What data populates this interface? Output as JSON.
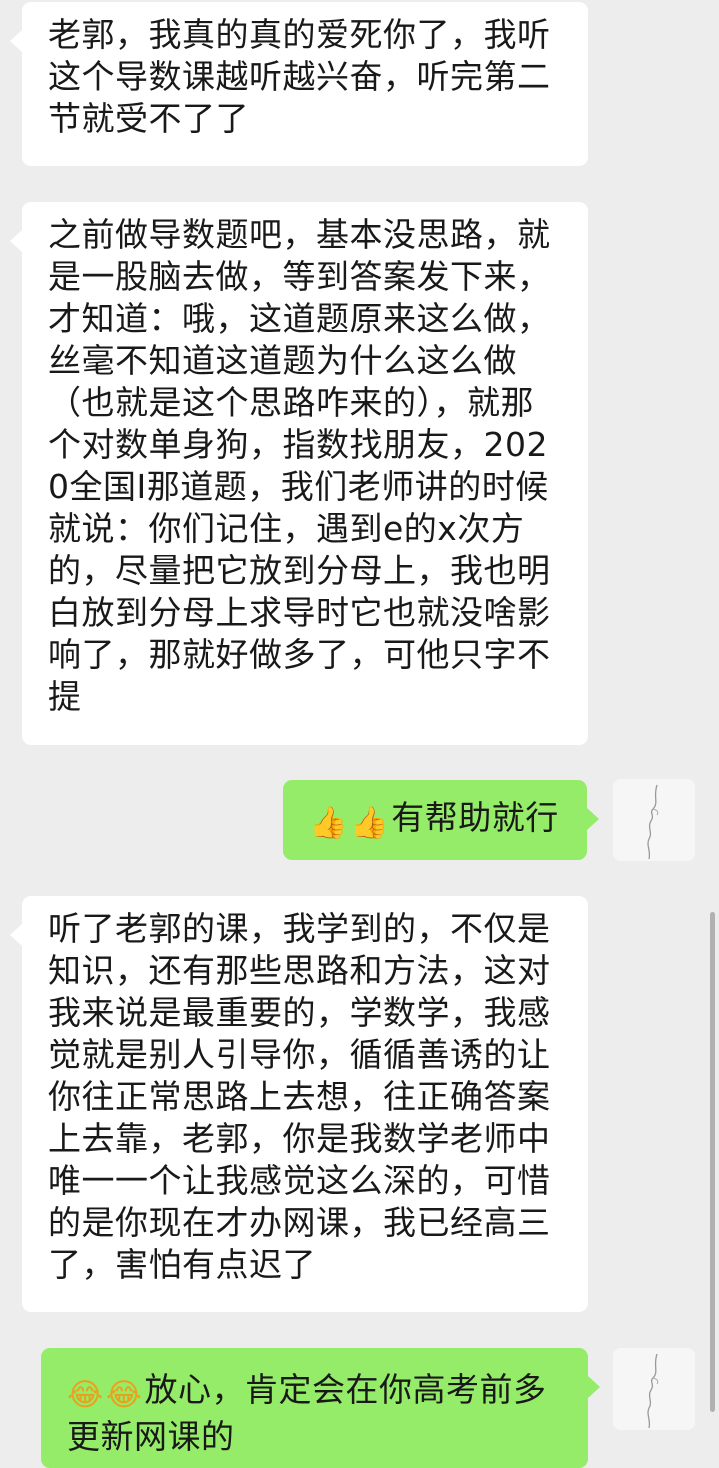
{
  "messages": [
    {
      "side": "in",
      "text": "老郭，我真的真的爱死你了，我听这个导数课越听越兴奋，听完第二节就受不了了"
    },
    {
      "side": "in",
      "text": "之前做导数题吧，基本没思路，就是一股脑去做，等到答案发下来，才知道：哦，这道题原来这么做，丝毫不知道这道题为什么这么做（也就是这个思路咋来的），就那个对数单身狗，指数找朋友，2020全国I那道题，我们老师讲的时候就说：你们记住，遇到e的x次方的，尽量把它放到分母上，我也明白放到分母上求导时它也就没啥影响了，那就好做多了，可他只字不提"
    },
    {
      "side": "out",
      "emoji": [
        "thumbs-up-icon",
        "thumbs-up-icon"
      ],
      "text": "有帮助就行"
    },
    {
      "side": "in",
      "text": "听了老郭的课，我学到的，不仅是知识，还有那些思路和方法，这对我来说是最重要的，学数学，我感觉就是别人引导你，循循善诱的让你往正常思路上去想，往正确答案上去靠，老郭，你是我数学老师中唯一一个让我感觉这么深的，可惜的是你现在才办网课，我已经高三了，害怕有点迟了"
    },
    {
      "side": "out",
      "emoji": [
        "laughing-tears-icon",
        "laughing-tears-icon"
      ],
      "text": "放心，肯定会在你高考前多更新网课的"
    }
  ],
  "colors": {
    "background": "#ededed",
    "incoming_bubble": "#ffffff",
    "outgoing_bubble": "#95ec69",
    "text": "#191919"
  }
}
